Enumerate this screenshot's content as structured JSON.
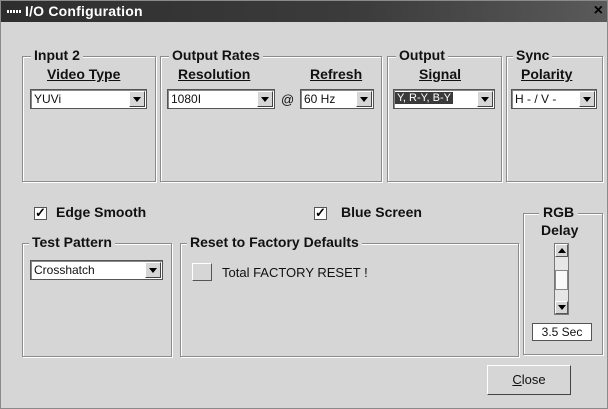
{
  "window": {
    "title": "I/O Configuration",
    "close_glyph": "×"
  },
  "input": {
    "legend": "Input 2",
    "video_type_label": "Video Type",
    "video_type_value": "YUVi"
  },
  "output_rates": {
    "legend": "Output Rates",
    "resolution_label": "Resolution",
    "resolution_value": "1080I",
    "at_symbol": "@",
    "refresh_label": "Refresh",
    "refresh_value": "60 Hz"
  },
  "output": {
    "legend": "Output",
    "signal_label": "Signal",
    "signal_value": "Y, R-Y, B-Y"
  },
  "sync": {
    "legend": "Sync",
    "polarity_label": "Polarity",
    "polarity_value": "H - / V -"
  },
  "options": {
    "edge_smooth_label": "Edge Smooth",
    "edge_smooth_checked": true,
    "blue_screen_label": "Blue Screen",
    "blue_screen_checked": true
  },
  "test_pattern": {
    "legend": "Test Pattern",
    "value": "Crosshatch"
  },
  "reset": {
    "legend": "Reset to Factory Defaults",
    "button_text": "Total FACTORY RESET !"
  },
  "rgb_delay": {
    "legend_line1": "RGB",
    "legend_line2": "Delay",
    "value": "3.5 Sec"
  },
  "close_button": {
    "label": "Close",
    "accelerator": "C"
  }
}
